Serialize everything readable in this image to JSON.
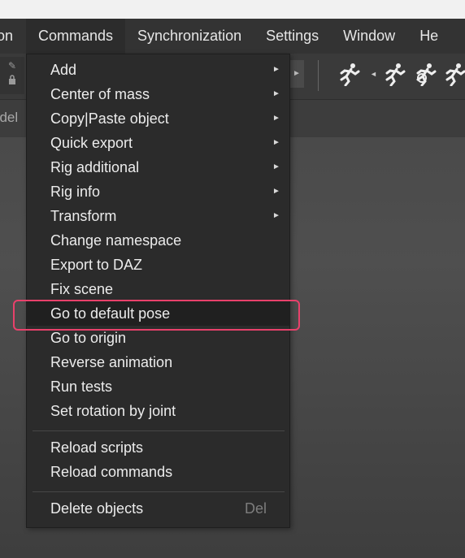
{
  "menubar": {
    "items": [
      {
        "label": "on"
      },
      {
        "label": "Commands"
      },
      {
        "label": "Synchronization"
      },
      {
        "label": "Settings"
      },
      {
        "label": "Window"
      },
      {
        "label": "He"
      }
    ]
  },
  "tabrow": {
    "partial_label": "odel"
  },
  "commands_menu": {
    "groups": [
      [
        {
          "label": "Add",
          "submenu": true
        },
        {
          "label": "Center of mass",
          "submenu": true
        },
        {
          "label": "Copy|Paste object",
          "submenu": true
        },
        {
          "label": "Quick export",
          "submenu": true
        },
        {
          "label": "Rig additional",
          "submenu": true
        },
        {
          "label": "Rig info",
          "submenu": true
        },
        {
          "label": "Transform",
          "submenu": true
        },
        {
          "label": "Change namespace"
        },
        {
          "label": "Export to DAZ"
        },
        {
          "label": "Fix scene"
        },
        {
          "label": "Go to default pose",
          "highlighted": true
        },
        {
          "label": "Go to origin"
        },
        {
          "label": "Reverse animation"
        },
        {
          "label": "Run tests"
        },
        {
          "label": "Set rotation by joint"
        }
      ],
      [
        {
          "label": "Reload scripts"
        },
        {
          "label": "Reload commands"
        }
      ],
      [
        {
          "label": "Delete objects",
          "shortcut": "Del"
        }
      ]
    ]
  },
  "colors": {
    "menubar_bg": "#333333",
    "menu_bg": "#2b2b2b",
    "highlight_outline": "#e8416b",
    "shortcut_text": "#7d7d7d"
  },
  "icons": [
    "submenu-arrow-icon",
    "running-figure-icon",
    "lock-icon",
    "pin-icon"
  ]
}
